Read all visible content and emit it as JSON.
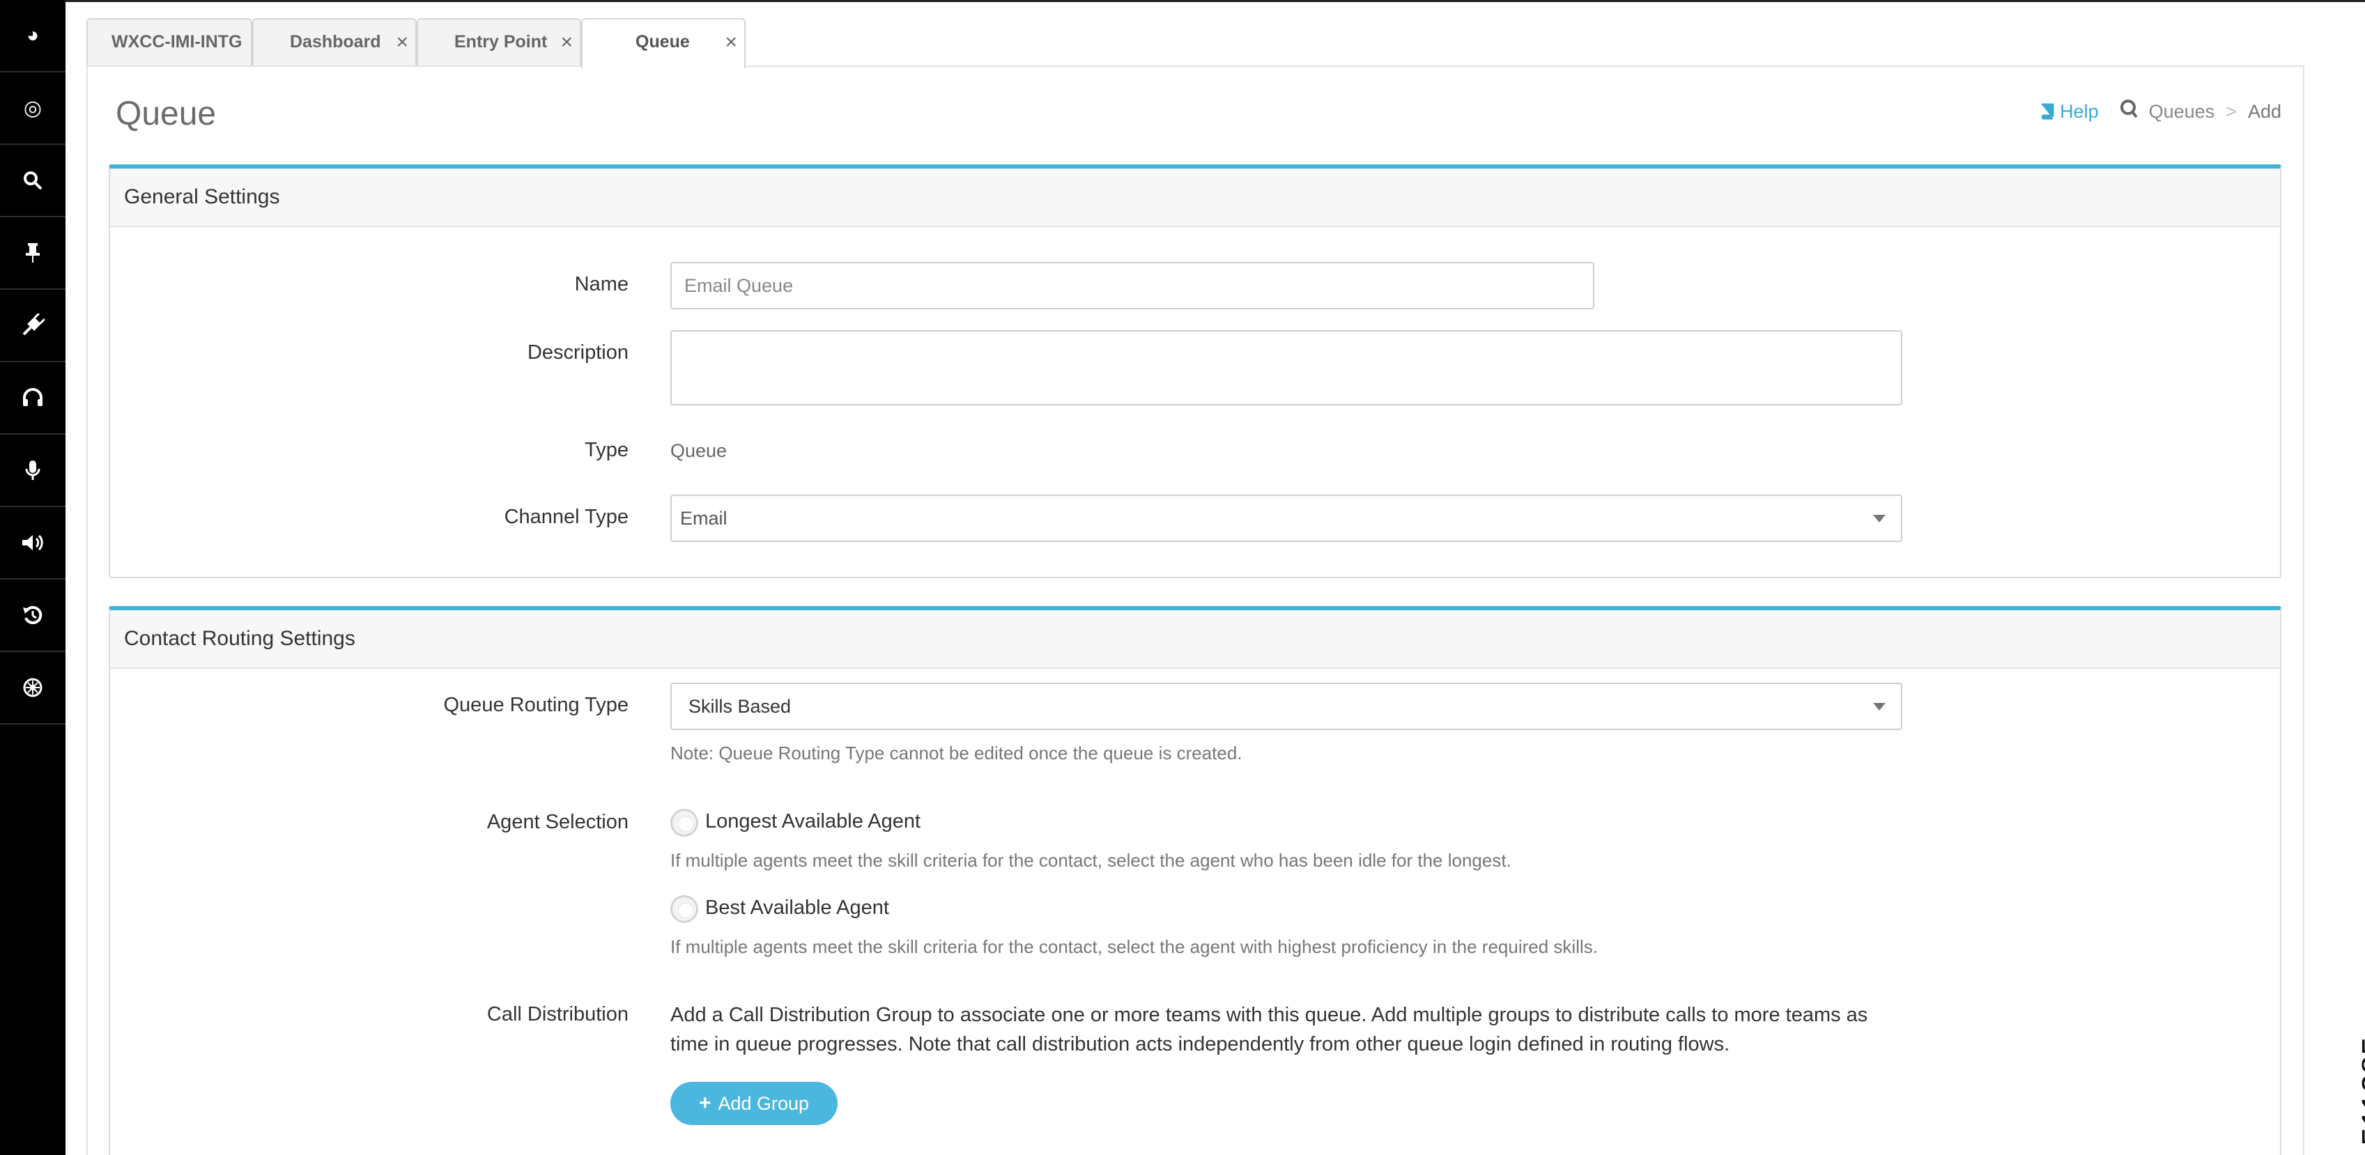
{
  "nav_rail": {
    "items": [
      {
        "icon": "dashboard-icon",
        "glyph": "◕"
      },
      {
        "icon": "target-icon",
        "glyph": "◎"
      },
      {
        "icon": "search-icon",
        "glyph": "⚲"
      },
      {
        "icon": "pin-icon",
        "glyph": "⊤"
      },
      {
        "icon": "plug-icon",
        "glyph": "⚡"
      },
      {
        "icon": "headset-icon",
        "glyph": "∩"
      },
      {
        "icon": "microphone-icon",
        "glyph": "⚬"
      },
      {
        "icon": "speaker-icon",
        "glyph": "◀"
      },
      {
        "icon": "history-icon",
        "glyph": "↺"
      },
      {
        "icon": "settings-icon",
        "glyph": "✲"
      }
    ]
  },
  "tabs": [
    {
      "label": "WXCC-IMI-INTG",
      "closable": false,
      "active": false
    },
    {
      "label": "Dashboard",
      "closable": true,
      "active": false
    },
    {
      "label": "Entry Point",
      "closable": true,
      "active": false
    },
    {
      "label": "Queue",
      "closable": true,
      "active": true
    }
  ],
  "tab_close_glyph": "×",
  "page": {
    "title": "Queue",
    "help_label": "Help",
    "breadcrumb": [
      "Queues",
      "Add"
    ],
    "breadcrumb_sep": ">"
  },
  "general_settings": {
    "header": "General Settings",
    "name_label": "Name",
    "name_placeholder": "Email Queue",
    "description_label": "Description",
    "description_value": "",
    "type_label": "Type",
    "type_value": "Queue",
    "channel_type_label": "Channel Type",
    "channel_type_value": "Email"
  },
  "contact_routing": {
    "header": "Contact Routing Settings",
    "routing_type_label": "Queue Routing Type",
    "routing_type_value": "Skills Based",
    "routing_type_note": "Note: Queue Routing Type cannot be edited once the queue is created.",
    "agent_selection_label": "Agent Selection",
    "options": [
      {
        "label": "Longest Available Agent",
        "help": "If multiple agents meet the skill criteria for the contact, select the agent who has been idle for the longest."
      },
      {
        "label": "Best Available Agent",
        "help": "If multiple agents meet the skill criteria for the contact, select the agent with highest proficiency in the required skills."
      }
    ],
    "call_distribution_label": "Call Distribution",
    "call_distribution_text": "Add a Call Distribution Group to associate one or more teams with this queue. Add multiple groups to distribute calls to more teams as time in queue progresses. Note that call distribution acts independently from other queue login defined in routing flows.",
    "add_group_label": "Add Group",
    "add_group_glyph": "+"
  },
  "figure_id": "511285",
  "colors": {
    "accent": "#3fb3d8",
    "button": "#4bb6de",
    "rail": "#000000"
  }
}
